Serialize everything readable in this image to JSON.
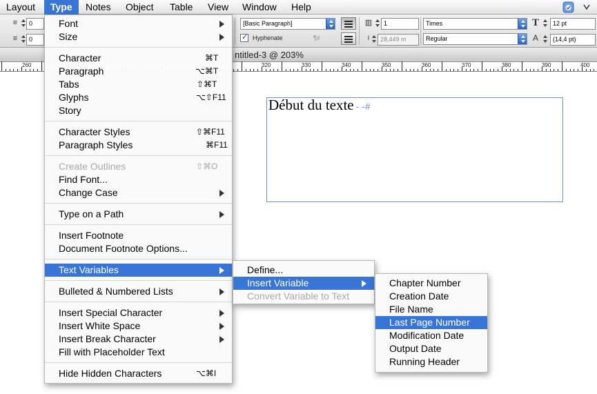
{
  "menubar": {
    "items": [
      {
        "label": "Layout"
      },
      {
        "label": "Type"
      },
      {
        "label": "Notes"
      },
      {
        "label": "Object"
      },
      {
        "label": "Table"
      },
      {
        "label": "View"
      },
      {
        "label": "Window"
      },
      {
        "label": "Help"
      }
    ],
    "active_item": "Type"
  },
  "control_panel": {
    "left_field_1": "0",
    "left_field_2": "0",
    "paragraph_style": "[Basic Paragraph]",
    "hyphenate_label": "Hyphenate",
    "hyphenate_checked": true,
    "columns_value": "1",
    "gutter_value": "28,449 m",
    "font_family": "Times",
    "font_style": "Regular",
    "font_size": "12 pt",
    "leading": "(14,4 pt)"
  },
  "document": {
    "title": "ntitled-3 @ 203%",
    "frame_text": "Début du texte",
    "frame_marks": "- -#"
  },
  "ruler": {
    "labels": [
      "260",
      "320",
      "330",
      "340",
      "350",
      "360",
      "370",
      "380",
      "390",
      "400"
    ]
  },
  "type_menu": {
    "items": [
      {
        "label": "Font",
        "shortcut": "",
        "submenu": true,
        "disabled": false
      },
      {
        "label": "Size",
        "shortcut": "",
        "submenu": true,
        "disabled": false
      },
      {
        "label": "Character",
        "shortcut": "⌘T",
        "submenu": false,
        "disabled": false
      },
      {
        "label": "Paragraph",
        "shortcut": "⌥⌘T",
        "submenu": false,
        "disabled": false
      },
      {
        "label": "Tabs",
        "shortcut": "⇧⌘T",
        "submenu": false,
        "disabled": false
      },
      {
        "label": "Glyphs",
        "shortcut": "⌥⇧F11",
        "submenu": false,
        "disabled": false
      },
      {
        "label": "Story",
        "shortcut": "",
        "submenu": false,
        "disabled": false
      },
      {
        "label": "Character Styles",
        "shortcut": "⇧⌘F11",
        "submenu": false,
        "disabled": false
      },
      {
        "label": "Paragraph Styles",
        "shortcut": "⌘F11",
        "submenu": false,
        "disabled": false
      },
      {
        "label": "Create Outlines",
        "shortcut": "⇧⌘O",
        "submenu": false,
        "disabled": true
      },
      {
        "label": "Find Font...",
        "shortcut": "",
        "submenu": false,
        "disabled": false
      },
      {
        "label": "Change Case",
        "shortcut": "",
        "submenu": true,
        "disabled": false
      },
      {
        "label": "Type on a Path",
        "shortcut": "",
        "submenu": true,
        "disabled": false
      },
      {
        "label": "Insert Footnote",
        "shortcut": "",
        "submenu": false,
        "disabled": false
      },
      {
        "label": "Document Footnote Options...",
        "shortcut": "",
        "submenu": false,
        "disabled": false
      },
      {
        "label": "Text Variables",
        "shortcut": "",
        "submenu": true,
        "disabled": false,
        "highlighted": true
      },
      {
        "label": "Bulleted & Numbered Lists",
        "shortcut": "",
        "submenu": true,
        "disabled": false
      },
      {
        "label": "Insert Special Character",
        "shortcut": "",
        "submenu": true,
        "disabled": false
      },
      {
        "label": "Insert White Space",
        "shortcut": "",
        "submenu": true,
        "disabled": false
      },
      {
        "label": "Insert Break Character",
        "shortcut": "",
        "submenu": true,
        "disabled": false
      },
      {
        "label": "Fill with Placeholder Text",
        "shortcut": "",
        "submenu": false,
        "disabled": false
      },
      {
        "label": "Hide Hidden Characters",
        "shortcut": "⌥⌘I",
        "submenu": false,
        "disabled": false
      }
    ]
  },
  "text_variables_menu": {
    "items": [
      {
        "label": "Define...",
        "submenu": false,
        "disabled": false
      },
      {
        "label": "Insert Variable",
        "submenu": true,
        "disabled": false,
        "highlighted": true
      },
      {
        "label": "Convert Variable to Text",
        "submenu": false,
        "disabled": true
      }
    ]
  },
  "insert_variable_menu": {
    "items": [
      {
        "label": "Chapter Number"
      },
      {
        "label": "Creation Date"
      },
      {
        "label": "File Name"
      },
      {
        "label": "Last Page Number",
        "highlighted": true
      },
      {
        "label": "Modification Date"
      },
      {
        "label": "Output Date"
      },
      {
        "label": "Running Header"
      }
    ]
  },
  "colors": {
    "highlight": "#3875d7",
    "frame_border": "#6d8fd6",
    "disabled_text": "#a9a9a9"
  }
}
